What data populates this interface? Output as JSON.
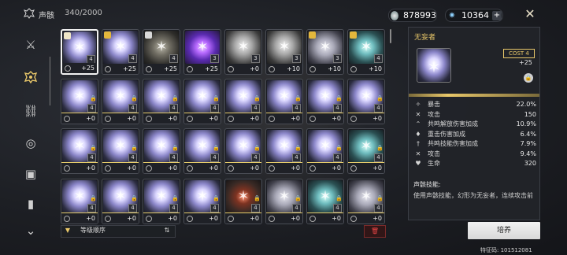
{
  "header": {
    "title": "声骸",
    "count": "340/2000",
    "currency_shell": "878993",
    "currency_crystal": "10364",
    "crystal_add_label": "+"
  },
  "sidebar": {
    "items": [
      {
        "icon": "crossed-swords-icon",
        "active": false
      },
      {
        "icon": "echo-mask-icon",
        "active": true
      },
      {
        "icon": "chain-link-icon",
        "active": false
      },
      {
        "icon": "target-icon",
        "active": false
      },
      {
        "icon": "cassette-icon",
        "active": false
      },
      {
        "icon": "journal-icon",
        "active": false
      },
      {
        "icon": "more-icon",
        "active": false
      }
    ]
  },
  "grid": {
    "rows": [
      [
        {
          "art": "white",
          "badge": "light",
          "cost": "4",
          "level": "+25",
          "selected": true,
          "gold": false,
          "lock": false
        },
        {
          "art": "white",
          "badge": "gold",
          "cost": "4",
          "level": "+25",
          "selected": false,
          "gold": false,
          "lock": false
        },
        {
          "art": "dark",
          "badge": "dk",
          "cost": "4",
          "level": "+25",
          "selected": false,
          "gold": false,
          "lock": false
        },
        {
          "art": "purple",
          "badge": "none",
          "cost": "3",
          "level": "+25",
          "selected": false,
          "gold": false,
          "lock": false
        },
        {
          "art": "grey",
          "badge": "none",
          "cost": "3",
          "level": "+0",
          "selected": false,
          "gold": false,
          "lock": false
        },
        {
          "art": "grey",
          "badge": "none",
          "cost": "3",
          "level": "+10",
          "selected": false,
          "gold": false,
          "lock": false
        },
        {
          "art": "ghost",
          "badge": "gold",
          "cost": "3",
          "level": "+10",
          "selected": false,
          "gold": false,
          "lock": false
        },
        {
          "art": "teal",
          "badge": "gold",
          "cost": "4",
          "level": "+10",
          "selected": false,
          "gold": false,
          "lock": false
        }
      ],
      [
        {
          "art": "white",
          "badge": "none",
          "cost": "4",
          "level": "+0",
          "selected": false,
          "gold": true,
          "lock": true
        },
        {
          "art": "white",
          "badge": "none",
          "cost": "4",
          "level": "+0",
          "selected": false,
          "gold": true,
          "lock": true
        },
        {
          "art": "white",
          "badge": "none",
          "cost": "4",
          "level": "+0",
          "selected": false,
          "gold": true,
          "lock": true
        },
        {
          "art": "white",
          "badge": "none",
          "cost": "4",
          "level": "+0",
          "selected": false,
          "gold": true,
          "lock": true
        },
        {
          "art": "white",
          "badge": "none",
          "cost": "4",
          "level": "+0",
          "selected": false,
          "gold": true,
          "lock": true
        },
        {
          "art": "white",
          "badge": "none",
          "cost": "4",
          "level": "+0",
          "selected": false,
          "gold": true,
          "lock": true
        },
        {
          "art": "white",
          "badge": "none",
          "cost": "4",
          "level": "+0",
          "selected": false,
          "gold": true,
          "lock": true
        },
        {
          "art": "white",
          "badge": "none",
          "cost": "4",
          "level": "+0",
          "selected": false,
          "gold": true,
          "lock": true
        }
      ],
      [
        {
          "art": "white",
          "badge": "none",
          "cost": "4",
          "level": "+0",
          "selected": false,
          "gold": true,
          "lock": true
        },
        {
          "art": "white",
          "badge": "none",
          "cost": "4",
          "level": "+0",
          "selected": false,
          "gold": true,
          "lock": true
        },
        {
          "art": "white",
          "badge": "none",
          "cost": "4",
          "level": "+0",
          "selected": false,
          "gold": true,
          "lock": true
        },
        {
          "art": "white",
          "badge": "none",
          "cost": "4",
          "level": "+0",
          "selected": false,
          "gold": true,
          "lock": true
        },
        {
          "art": "white",
          "badge": "none",
          "cost": "4",
          "level": "+0",
          "selected": false,
          "gold": true,
          "lock": true
        },
        {
          "art": "white",
          "badge": "none",
          "cost": "4",
          "level": "+0",
          "selected": false,
          "gold": true,
          "lock": true
        },
        {
          "art": "white",
          "badge": "none",
          "cost": "4",
          "level": "+0",
          "selected": false,
          "gold": true,
          "lock": true
        },
        {
          "art": "teal",
          "badge": "none",
          "cost": "4",
          "level": "+0",
          "selected": false,
          "gold": true,
          "lock": true
        }
      ],
      [
        {
          "art": "white",
          "badge": "none",
          "cost": "4",
          "level": "+0",
          "selected": false,
          "gold": true,
          "lock": true
        },
        {
          "art": "white",
          "badge": "none",
          "cost": "4",
          "level": "+0",
          "selected": false,
          "gold": true,
          "lock": true
        },
        {
          "art": "white",
          "badge": "none",
          "cost": "4",
          "level": "+0",
          "selected": false,
          "gold": true,
          "lock": true
        },
        {
          "art": "white",
          "badge": "none",
          "cost": "4",
          "level": "+0",
          "selected": false,
          "gold": true,
          "lock": true
        },
        {
          "art": "red",
          "badge": "none",
          "cost": "4",
          "level": "+0",
          "selected": false,
          "gold": true,
          "lock": true
        },
        {
          "art": "ghost",
          "badge": "none",
          "cost": "4",
          "level": "+0",
          "selected": false,
          "gold": true,
          "lock": true
        },
        {
          "art": "teal",
          "badge": "none",
          "cost": "4",
          "level": "+0",
          "selected": false,
          "gold": true,
          "lock": true
        },
        {
          "art": "ghost",
          "badge": "none",
          "cost": "4",
          "level": "+0",
          "selected": false,
          "gold": true,
          "lock": true
        }
      ]
    ]
  },
  "detail": {
    "name": "无妄者",
    "cost_label": "COST 4",
    "level": "+25",
    "stats": [
      {
        "icon": "crit-icon",
        "name": "暴击",
        "value": "22.0%"
      },
      {
        "icon": "attack-icon",
        "name": "攻击",
        "value": "150"
      },
      {
        "icon": "liberation-icon",
        "name": "共鸣解放伤害加成",
        "value": "10.9%"
      },
      {
        "icon": "heavy-attack-icon",
        "name": "重击伤害加成",
        "value": "6.4%"
      },
      {
        "icon": "skill-icon",
        "name": "共鸣技能伤害加成",
        "value": "7.9%"
      },
      {
        "icon": "attack-icon",
        "name": "攻击",
        "value": "9.4%"
      },
      {
        "icon": "hp-icon",
        "name": "生命",
        "value": "320"
      }
    ],
    "skill_title": "声骸技能:",
    "skill_text": "使用声骸技能，幻形为无妄者，连续攻击前"
  },
  "toolbar": {
    "sort_label": "等级顺序",
    "train_label": "培养",
    "uid": "特征码: 101512081"
  },
  "colors": {
    "accent_gold": "#e9c86a",
    "trash_red": "#e64545"
  }
}
